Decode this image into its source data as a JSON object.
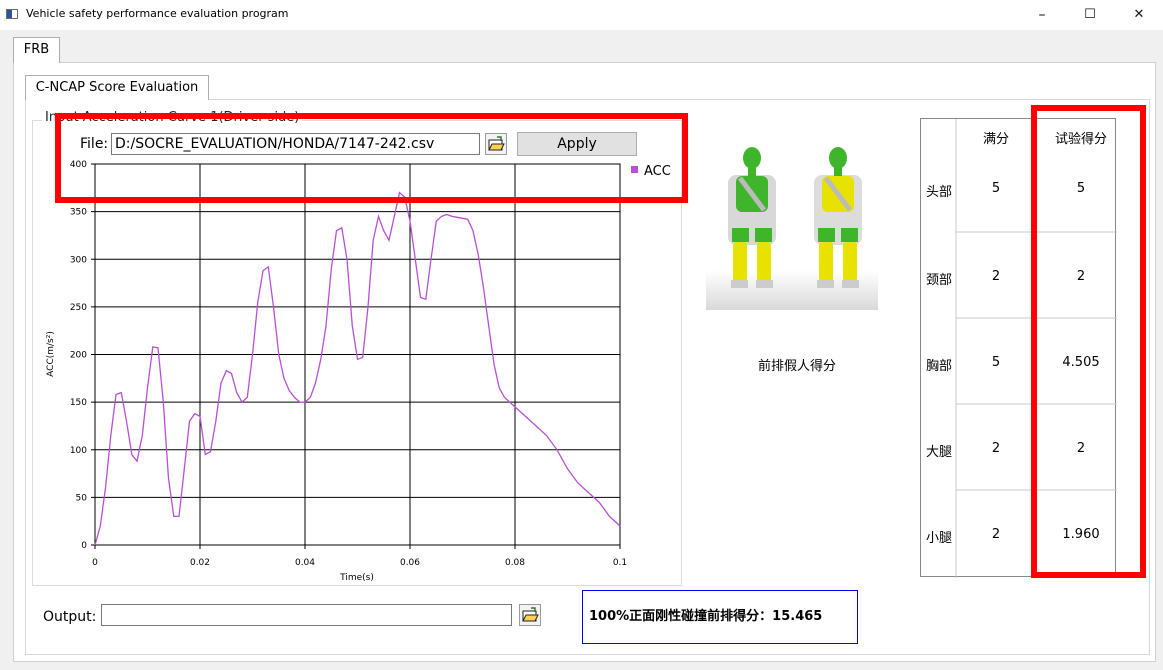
{
  "window": {
    "title": "Vehicle safety performance evaluation program",
    "minimize_glyph": "–",
    "maximize_glyph": "☐",
    "close_glyph": "✕"
  },
  "tabs": {
    "main": "FRB",
    "sub": "C-NCAP Score Evaluation"
  },
  "group": {
    "title": "Input Acceleration Curve 1(Driver side)"
  },
  "file": {
    "label": "File:",
    "value": "D:/SOCRE_EVALUATION/HONDA/7147-242.csv",
    "apply_label": "Apply"
  },
  "chart_data": {
    "type": "line",
    "title": "",
    "xlabel": "Time(s)",
    "ylabel": "ACC(m/s²)",
    "xlim": [
      0,
      0.1
    ],
    "ylim": [
      0,
      400
    ],
    "xticks": [
      "0",
      "0.02",
      "0.04",
      "0.06",
      "0.08",
      "0.1"
    ],
    "yticks": [
      "0",
      "50",
      "100",
      "150",
      "200",
      "250",
      "300",
      "350",
      "400"
    ],
    "grid": true,
    "legend_position": "top-right",
    "series": [
      {
        "name": "ACC",
        "color": "#b84fd6",
        "x": [
          0,
          0.001,
          0.002,
          0.003,
          0.004,
          0.005,
          0.006,
          0.007,
          0.008,
          0.009,
          0.01,
          0.011,
          0.012,
          0.013,
          0.014,
          0.015,
          0.016,
          0.017,
          0.018,
          0.019,
          0.02,
          0.021,
          0.022,
          0.023,
          0.024,
          0.025,
          0.026,
          0.027,
          0.028,
          0.029,
          0.03,
          0.031,
          0.032,
          0.033,
          0.034,
          0.035,
          0.036,
          0.037,
          0.038,
          0.039,
          0.04,
          0.041,
          0.042,
          0.043,
          0.044,
          0.045,
          0.046,
          0.047,
          0.048,
          0.049,
          0.05,
          0.051,
          0.052,
          0.053,
          0.054,
          0.055,
          0.056,
          0.057,
          0.058,
          0.059,
          0.06,
          0.061,
          0.062,
          0.063,
          0.064,
          0.065,
          0.066,
          0.067,
          0.068,
          0.069,
          0.07,
          0.071,
          0.072,
          0.073,
          0.074,
          0.075,
          0.076,
          0.077,
          0.078,
          0.079,
          0.08,
          0.082,
          0.084,
          0.086,
          0.088,
          0.09,
          0.092,
          0.094,
          0.096,
          0.098,
          0.1
        ],
        "y": [
          0,
          20,
          60,
          115,
          158,
          160,
          130,
          95,
          88,
          115,
          165,
          208,
          207,
          150,
          70,
          30,
          30,
          80,
          130,
          138,
          135,
          95,
          98,
          130,
          170,
          183,
          180,
          160,
          150,
          155,
          200,
          255,
          288,
          292,
          250,
          200,
          175,
          162,
          155,
          150,
          150,
          155,
          170,
          195,
          230,
          290,
          330,
          333,
          300,
          230,
          195,
          197,
          250,
          320,
          345,
          330,
          320,
          345,
          370,
          365,
          340,
          300,
          260,
          258,
          300,
          340,
          345,
          347,
          345,
          344,
          343,
          342,
          330,
          305,
          270,
          230,
          190,
          165,
          155,
          150,
          145,
          135,
          125,
          115,
          100,
          80,
          65,
          55,
          45,
          30,
          20
        ]
      }
    ]
  },
  "dummy": {
    "caption": "前排假人得分"
  },
  "score_table": {
    "headers": [
      "满分",
      "试验得分"
    ],
    "rows": [
      {
        "part": "头部",
        "full": "5",
        "score": "5"
      },
      {
        "part": "颈部",
        "full": "2",
        "score": "2"
      },
      {
        "part": "胸部",
        "full": "5",
        "score": "4.505"
      },
      {
        "part": "大腿",
        "full": "2",
        "score": "2"
      },
      {
        "part": "小腿",
        "full": "2",
        "score": "1.960"
      }
    ]
  },
  "output": {
    "label": "Output:",
    "value": ""
  },
  "result": {
    "text": "100%正面刚性碰撞前排得分：15.465"
  },
  "colors": {
    "highlight": "#ff0000",
    "result_border": "#0000ff",
    "series": "#b84fd6",
    "dummy_green": "#3fb52c",
    "dummy_yellow": "#e8e200"
  }
}
